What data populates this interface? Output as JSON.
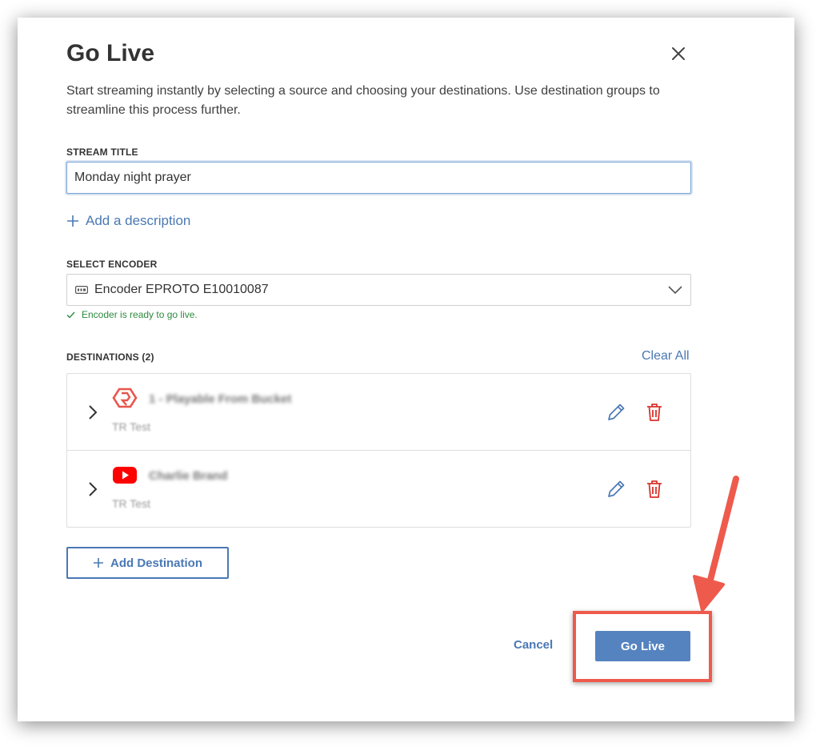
{
  "modal": {
    "title": "Go Live",
    "intro": "Start streaming instantly by selecting a source and choosing your destinations. Use destination groups to streamline this process further."
  },
  "stream_title": {
    "label": "STREAM TITLE",
    "value": "Monday night prayer"
  },
  "add_description_label": "Add a description",
  "encoder": {
    "label": "SELECT ENCODER",
    "selected": "Encoder EPROTO E10010087",
    "status": "Encoder is ready to go live."
  },
  "destinations": {
    "label": "DESTINATIONS (2)",
    "clear_all": "Clear All",
    "items": [
      {
        "name": "1 - Playable From Bucket",
        "subtitle": "TR Test",
        "logo": "bucket-logo-icon"
      },
      {
        "name": "Charlie Brand",
        "subtitle": "TR Test",
        "logo": "youtube-logo-icon"
      }
    ],
    "add_label": "Add Destination"
  },
  "footer": {
    "cancel": "Cancel",
    "go_live": "Go Live"
  },
  "colors": {
    "accent": "#4a78b5",
    "primary_button": "#5583c0",
    "success": "#2e8b3e",
    "danger": "#d9342b",
    "annotation": "#ee5a4c",
    "youtube": "#ff0000"
  }
}
